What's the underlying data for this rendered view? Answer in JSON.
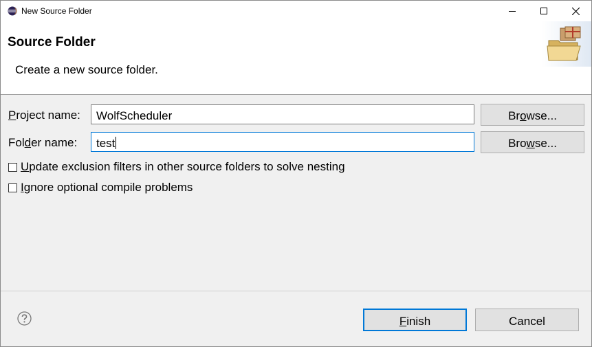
{
  "window": {
    "title": "New Source Folder",
    "app_icon": "eclipse-icon",
    "controls": [
      "minimize-icon",
      "maximize-icon",
      "close-icon"
    ]
  },
  "header": {
    "title": "Source Folder",
    "description": "Create a new source folder.",
    "image": "package-folder-icon"
  },
  "form": {
    "project": {
      "label_pre": "",
      "label_mnemonic": "P",
      "label_post": "roject name:",
      "value": "WolfScheduler",
      "browse_pre": "Br",
      "browse_mnemonic": "o",
      "browse_post": "wse..."
    },
    "folder": {
      "label_pre": "Fol",
      "label_mnemonic": "d",
      "label_post": "er name:",
      "value": "test",
      "browse_pre": "Bro",
      "browse_mnemonic": "w",
      "browse_post": "se..."
    },
    "checkboxes": [
      {
        "mnemonic": "U",
        "rest": "pdate exclusion filters in other source folders to solve nesting",
        "checked": false
      },
      {
        "mnemonic": "I",
        "rest": "gnore optional compile problems",
        "checked": false
      }
    ]
  },
  "footer": {
    "help_icon": "help-icon",
    "finish_mnemonic": "F",
    "finish_rest": "inish",
    "cancel_label": "Cancel"
  },
  "colors": {
    "focus_border": "#0078d7",
    "default_button_border": "#0078d7",
    "button_bg": "#e1e1e1"
  }
}
